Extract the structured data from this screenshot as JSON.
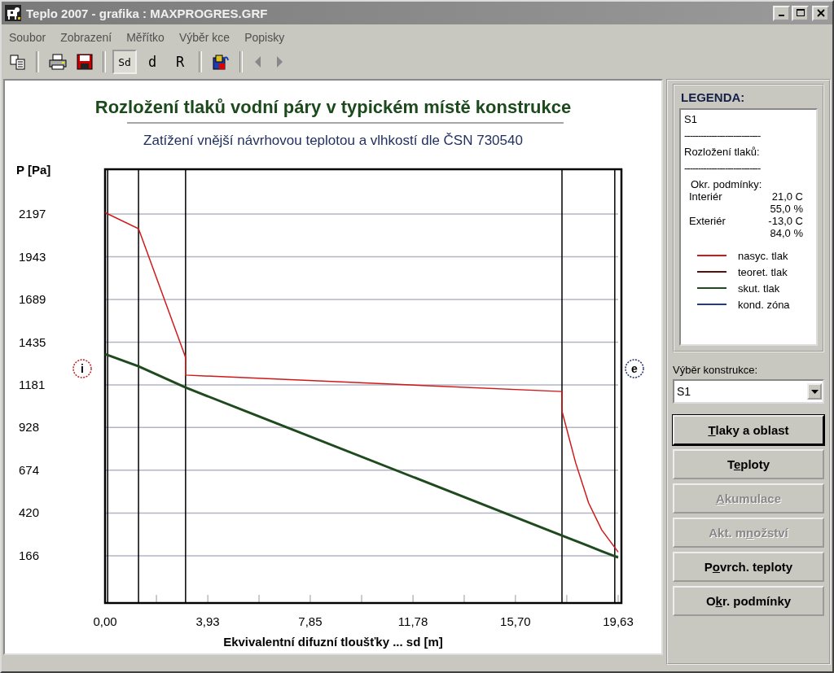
{
  "window": {
    "title": "Teplo 2007 - grafika : MAXPROGRES.GRF"
  },
  "menu": [
    "Soubor",
    "Zobrazení",
    "Měřítko",
    "Výběr kce",
    "Popisky"
  ],
  "toolbar_modes": [
    {
      "label": "Sd",
      "selected": true
    },
    {
      "label": "d",
      "selected": false
    },
    {
      "label": "R",
      "selected": false
    }
  ],
  "chart": {
    "title": "Rozložení tlaků vodní páry v typickém místě konstrukce",
    "subtitle": "Zatížení vnější návrhovou teplotou a vlhkostí dle ČSN 730540",
    "marker_left": "i",
    "marker_right": "e",
    "chart_data": {
      "type": "line",
      "xlabel": "Ekvivalentní difuzní tloušťky ... sd [m]",
      "ylabel": "P [Pa]",
      "x": [
        0,
        1.28,
        3.08,
        3.08,
        17.48,
        17.48,
        18.0,
        18.5,
        19.0,
        19.63
      ],
      "series": [
        {
          "name": "nasyc. tlak",
          "color": "#d01818",
          "values": [
            2205,
            2110,
            1345,
            1240,
            1142,
            1026,
            720,
            480,
            320,
            188
          ]
        },
        {
          "name": "teoret. tlak",
          "color": "#5a0e0e",
          "values": [
            null,
            null,
            null,
            null,
            null,
            null,
            null,
            null,
            null,
            null
          ]
        },
        {
          "name": "skut. tlak",
          "color": "#1e4a1e",
          "values": [
            1364,
            1292,
            1166,
            1166,
            286,
            286,
            254,
            224,
            193,
            155
          ]
        },
        {
          "name": "kond. zóna",
          "color": "#233a8a",
          "values": [
            null,
            null,
            null,
            null,
            null,
            null,
            null,
            null,
            null,
            null
          ]
        }
      ],
      "xlim": [
        0,
        19.63
      ],
      "ylim": [
        -115,
        2463
      ],
      "xticks": [
        {
          "value": 0,
          "label": "0,00"
        },
        {
          "value": 3.93,
          "label": "3,93"
        },
        {
          "value": 7.85,
          "label": "7,85"
        },
        {
          "value": 11.78,
          "label": "11,78"
        },
        {
          "value": 15.7,
          "label": "15,70"
        },
        {
          "value": 19.63,
          "label": "19,63"
        }
      ],
      "yticks": [
        2197,
        1943,
        1689,
        1435,
        1181,
        928,
        674,
        420,
        166
      ],
      "grid": true
    }
  },
  "legend": {
    "title": "LEGENDA:",
    "name": "S1",
    "separator": "----------------------------",
    "heading": "Rozložení tlaků:",
    "conditions_title": "Okr. podmínky:",
    "conditions": [
      {
        "label": "Interiér",
        "values": [
          "21,0 C",
          "55,0 %"
        ]
      },
      {
        "label": "Exteriér",
        "values": [
          "-13,0 C",
          "84,0 %"
        ]
      }
    ]
  },
  "construction": {
    "label": "Výběr konstrukce:",
    "value": "S1"
  },
  "buttons": [
    {
      "hotkey": "T",
      "label_after": "laky a oblast",
      "default": true,
      "disabled": false
    },
    {
      "label_before": "T",
      "hotkey": "e",
      "label_after": "ploty",
      "default": false,
      "disabled": false
    },
    {
      "hotkey": "A",
      "label_after": "kumulace",
      "default": false,
      "disabled": true
    },
    {
      "label_before": "Akt. m",
      "hotkey": "n",
      "label_after": "ožství",
      "default": false,
      "disabled": true
    },
    {
      "label_before": "P",
      "hotkey": "o",
      "label_after": "vrch. teploty",
      "default": false,
      "disabled": false
    },
    {
      "label_before": "O",
      "hotkey": "k",
      "label_after": "r. podmínky",
      "default": false,
      "disabled": false
    }
  ]
}
